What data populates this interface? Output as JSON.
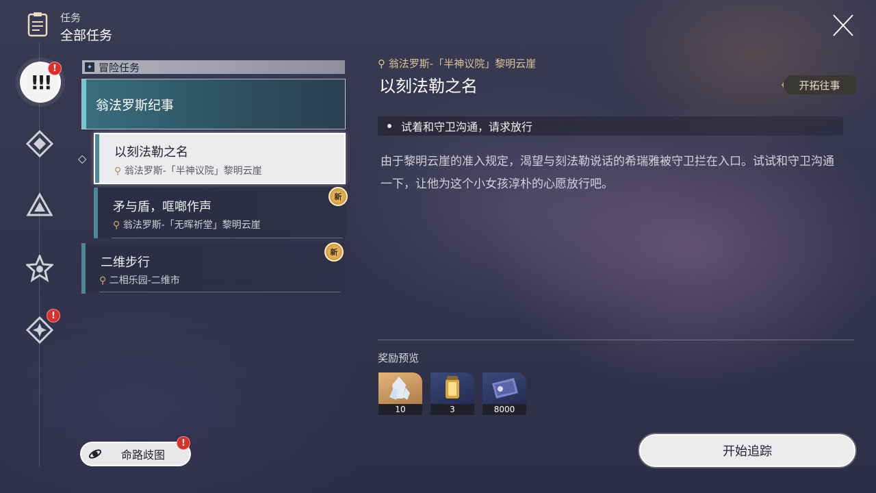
{
  "header": {
    "section": "任务",
    "title": "全部任务"
  },
  "category": {
    "icon": "compass-diamond-icon",
    "label": "冒险任务"
  },
  "chapter": {
    "label": "翁法罗斯纪事"
  },
  "quests": [
    {
      "name": "以刻法勒之名",
      "location": "翁法罗斯-「半神议院」黎明云崖",
      "selected": true
    },
    {
      "name": "矛与盾，哐啷作声",
      "location": "翁法罗斯-「无晖祈堂」黎明云崖",
      "badge": "新"
    },
    {
      "name": "二维步行",
      "location": "二相乐园-二维市",
      "badge": "新"
    }
  ],
  "detail": {
    "location": "翁法罗斯-「半神议院」黎明云崖",
    "title": "以刻法勒之名",
    "tag": "开拓往事",
    "objective": "试着和守卫沟通，请求放行",
    "description": "由于黎明云崖的准入规定，渴望与刻法勒说话的希瑞雅被守卫拦在入口。试试和守卫沟通一下，让他为这个小女孩淳朴的心愿放行吧。",
    "reward_label": "奖励预览",
    "rewards": [
      {
        "item": "crystal-reward-icon",
        "count": "10"
      },
      {
        "item": "lantern-reward-icon",
        "count": "3"
      },
      {
        "item": "credit-card-reward-icon",
        "count": "8000"
      }
    ],
    "track_button": "开始追踪"
  },
  "bottom_left": {
    "label": "命路歧图",
    "badge": "!"
  },
  "rail_badge": "!",
  "colors": {
    "accent_teal": "#4b8796",
    "gold": "#c9a86a",
    "alert_red": "#d8302c"
  }
}
